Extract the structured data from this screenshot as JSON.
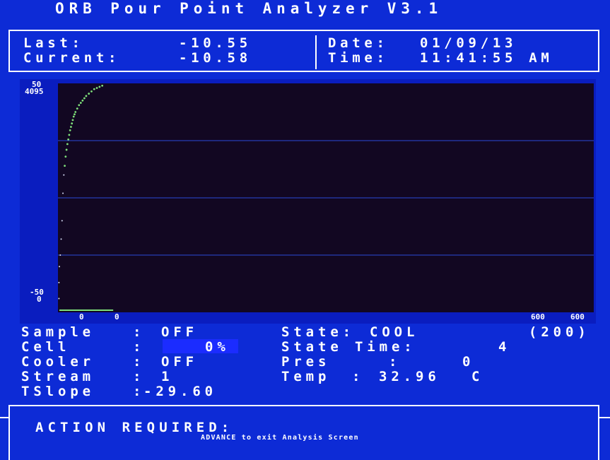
{
  "header": {
    "title": "ORB Pour Point Analyzer V3.1",
    "last_label": "Last:",
    "last_value": "-10.55",
    "current_label": "Current:",
    "current_value": "-10.58",
    "date_label": "Date:",
    "date_value": "01/09/13",
    "time_label": "Time:",
    "time_value": "11:41:55 AM"
  },
  "plot": {
    "y_top_labels": [
      "50",
      "4095"
    ],
    "y_bottom_labels": [
      "-50",
      "0"
    ],
    "x_labels": [
      "0",
      "0",
      "600",
      "600"
    ],
    "trace_color": "#7fe07a",
    "grid_color": "#2a4ad8",
    "trace_points": [
      [
        0.0,
        -30.0
      ],
      [
        1.0,
        -25.0
      ],
      [
        2.0,
        -18.0
      ],
      [
        3.0,
        -10.0
      ],
      [
        4.0,
        2.0
      ],
      [
        5.0,
        10.0
      ],
      [
        6.0,
        14.0
      ],
      [
        7.0,
        18.0
      ],
      [
        8.0,
        21.0
      ],
      [
        9.0,
        23.5
      ],
      [
        10.0,
        25.5
      ],
      [
        11.0,
        27.5
      ],
      [
        12.0,
        29.5
      ],
      [
        13.0,
        31.0
      ],
      [
        14.0,
        32.5
      ],
      [
        15.0,
        34.0
      ],
      [
        16.0,
        35.5
      ],
      [
        17.0,
        36.5
      ],
      [
        18.0,
        37.5
      ],
      [
        20.0,
        39.0
      ],
      [
        22.0,
        40.5
      ],
      [
        24.0,
        41.5
      ],
      [
        26.0,
        42.5
      ],
      [
        28.0,
        43.5
      ],
      [
        30.0,
        44.5
      ],
      [
        33.0,
        45.5
      ],
      [
        36.0,
        46.5
      ],
      [
        39.0,
        47.5
      ],
      [
        42.0,
        48.0
      ],
      [
        45.0,
        48.5
      ],
      [
        48.0,
        49.0
      ]
    ],
    "baseline": [
      [
        0,
        -50
      ],
      [
        50,
        -50
      ]
    ],
    "x_range": [
      0,
      600
    ],
    "y_range": [
      -50,
      50
    ]
  },
  "status": {
    "sample_label": "Sample",
    "sample_value": "OFF",
    "cell_label": "Cell",
    "cell_value": "0%",
    "cooler_label": "Cooler",
    "cooler_value": "OFF",
    "stream_label": "Stream",
    "stream_value": "1",
    "tslope_label": "TSlope",
    "tslope_value": "-29.60",
    "colon": ":",
    "state_label": "State:",
    "state_value": "COOL",
    "state_extra": "(200)",
    "state_time_label": "State Time:",
    "state_time_value": "4",
    "pres_label": "Pres",
    "pres_value": "0",
    "temp_label": "Temp",
    "temp_value": "32.96",
    "temp_unit": "C"
  },
  "footer": {
    "action_label": "ACTION REQUIRED:",
    "hint": "ADVANCE to exit Analysis Screen"
  }
}
